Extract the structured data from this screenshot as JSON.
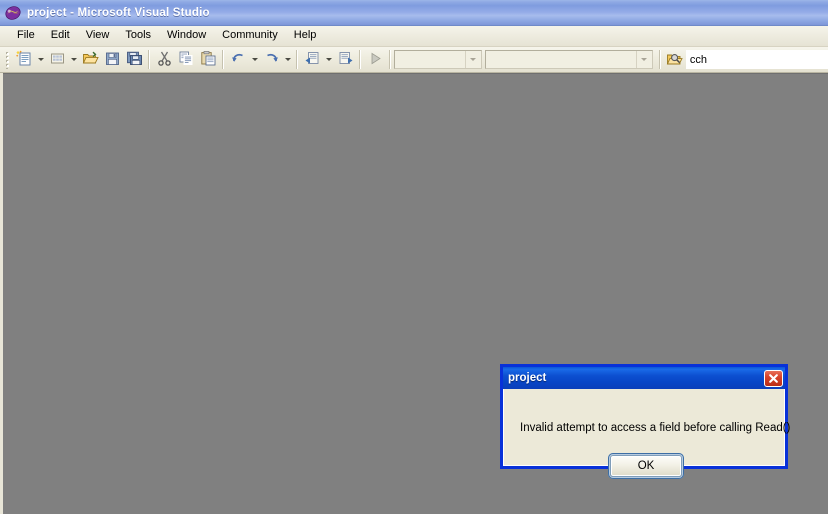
{
  "window": {
    "title": "project - Microsoft Visual Studio",
    "app_icon": "visual-studio-icon",
    "titlebar_gradient_start": "#9cb6e8",
    "titlebar_gradient_end": "#7d96d8",
    "client_background": "#808080"
  },
  "menubar": {
    "items": [
      {
        "label": "File"
      },
      {
        "label": "Edit"
      },
      {
        "label": "View"
      },
      {
        "label": "Tools"
      },
      {
        "label": "Window"
      },
      {
        "label": "Community"
      },
      {
        "label": "Help"
      }
    ]
  },
  "toolbar": {
    "buttons": [
      {
        "name": "new-project-icon",
        "tooltip": "New Project"
      },
      {
        "name": "add-new-item-icon",
        "tooltip": "Add New Item"
      },
      {
        "name": "open-file-icon",
        "tooltip": "Open File"
      },
      {
        "name": "save-icon",
        "tooltip": "Save"
      },
      {
        "name": "save-all-icon",
        "tooltip": "Save All"
      },
      {
        "name": "cut-icon",
        "tooltip": "Cut"
      },
      {
        "name": "copy-icon",
        "tooltip": "Copy"
      },
      {
        "name": "paste-icon",
        "tooltip": "Paste"
      },
      {
        "name": "undo-icon",
        "tooltip": "Undo"
      },
      {
        "name": "redo-icon",
        "tooltip": "Redo"
      },
      {
        "name": "navigate-backward-icon",
        "tooltip": "Navigate Backward"
      },
      {
        "name": "navigate-forward-icon",
        "tooltip": "Navigate Forward"
      },
      {
        "name": "start-debugging-icon",
        "tooltip": "Start Debugging"
      }
    ],
    "config_combo_value": "",
    "platform_combo_value": "",
    "find_icon": "find-in-files-icon",
    "find_value": "cch",
    "find_placeholder": ""
  },
  "dialog": {
    "title": "project",
    "message": "Invalid attempt to access a field before calling Read()",
    "ok_label": "OK",
    "close_icon": "close-x-icon",
    "border_color": "#0831d9",
    "titlebar_color": "#0a4fd0",
    "body_color": "#ece9d8"
  }
}
